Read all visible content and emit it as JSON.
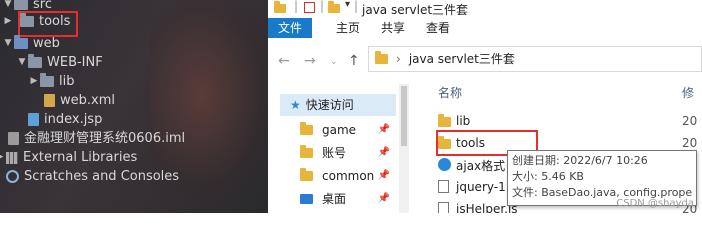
{
  "ide": {
    "tree": [
      {
        "label": "src",
        "kind": "folder"
      },
      {
        "label": "tools",
        "kind": "folder"
      },
      {
        "label": "web",
        "kind": "folder-blue"
      },
      {
        "label": "WEB-INF",
        "kind": "folder"
      },
      {
        "label": "lib",
        "kind": "folder"
      },
      {
        "label": "web.xml",
        "kind": "xml"
      },
      {
        "label": "index.jsp",
        "kind": "jsp"
      },
      {
        "label": "金融理财管理系统0606.iml",
        "kind": "iml"
      },
      {
        "label": "External Libraries",
        "kind": "library"
      },
      {
        "label": "Scratches and Consoles",
        "kind": "scratch"
      }
    ]
  },
  "explorer": {
    "title": "java servlet三件套",
    "ribbon_tabs": [
      "文件",
      "主页",
      "共享",
      "查看"
    ],
    "address_path": "java servlet三件套",
    "nav": [
      {
        "label": "快速访问",
        "icon": "star-icon"
      },
      {
        "label": "game",
        "icon": "folder-icon"
      },
      {
        "label": "账号",
        "icon": "folder-icon"
      },
      {
        "label": "common",
        "icon": "folder-icon"
      },
      {
        "label": "桌面",
        "icon": "desktop-icon"
      }
    ],
    "columns": {
      "name": "名称",
      "modified": "修"
    },
    "files": [
      {
        "name": "lib",
        "date": "20",
        "icon": "folder-icon"
      },
      {
        "name": "tools",
        "date": "20",
        "icon": "folder-icon"
      },
      {
        "name": "ajax格式",
        "date": "",
        "icon": "ajax-icon"
      },
      {
        "name": "jquery-1.",
        "date": "",
        "icon": "file-icon"
      },
      {
        "name": "jsHelper.js",
        "date": "20",
        "icon": "file-icon"
      }
    ],
    "tooltip": {
      "created": "创建日期: 2022/6/7 10:26",
      "size": "大小: 5.46 KB",
      "files": "文件: BaseDao.java, config.proper"
    },
    "watermark": "CSDN @shayda"
  },
  "colors": {
    "highlight_box": "#e3302f",
    "file_tab": "#1979ca"
  }
}
